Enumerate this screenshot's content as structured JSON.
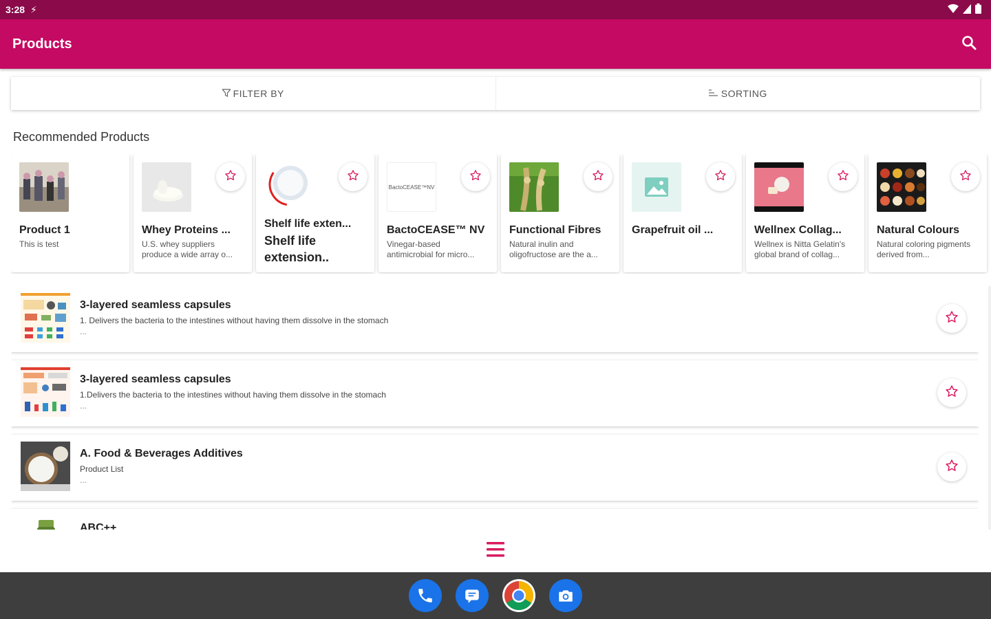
{
  "statusbar": {
    "time": "3:28",
    "bolt": "⚡"
  },
  "appbar": {
    "title": "Products"
  },
  "filters": {
    "filter_label": "FILTER BY",
    "sorting_label": "SORTING"
  },
  "section": {
    "recommended": "Recommended Products"
  },
  "cards": [
    {
      "name": "Product 1",
      "desc": "This is test"
    },
    {
      "name": "Whey Proteins ...",
      "desc": "U.S. whey suppliers produce a wide array o..."
    },
    {
      "name": "Shelf life exten...",
      "sub": "Shelf life extension.."
    },
    {
      "name": "BactoCEASE™ NV",
      "desc": "Vinegar-based antimicrobial for micro...",
      "thumb_text": "BactoCEASE™NV"
    },
    {
      "name": "Functional Fibres",
      "desc": "Natural inulin and oligofructose are the a..."
    },
    {
      "name": "Grapefruit oil ...",
      "desc": ""
    },
    {
      "name": "Wellnex Collag...",
      "desc": "Wellnex is Nitta Gelatin's global brand of collag..."
    },
    {
      "name": "Natural Colours",
      "desc": "Natural coloring pigments derived from..."
    }
  ],
  "list": [
    {
      "title": "3-layered seamless capsules",
      "sub": "1.   Delivers the bacteria to the intestines without having them dissolve in the stomach",
      "more": "..."
    },
    {
      "title": "3-layered seamless capsules",
      "sub": "1.Delivers the bacteria to the intestines without having them dissolve in the stomach",
      "more": "..."
    },
    {
      "title": "A. Food & Beverages Additives",
      "sub": "Product List",
      "more": "..."
    },
    {
      "title": "ABC++",
      "sub": "",
      "more": ""
    }
  ],
  "colors": {
    "status": "#8a0a4a",
    "primary": "#c40a62",
    "accent": "#d81b60",
    "nav": "#3e3e3e"
  },
  "icons": {
    "search": "search-icon",
    "star": "star-outline-icon",
    "menu": "hamburger-menu-icon"
  }
}
